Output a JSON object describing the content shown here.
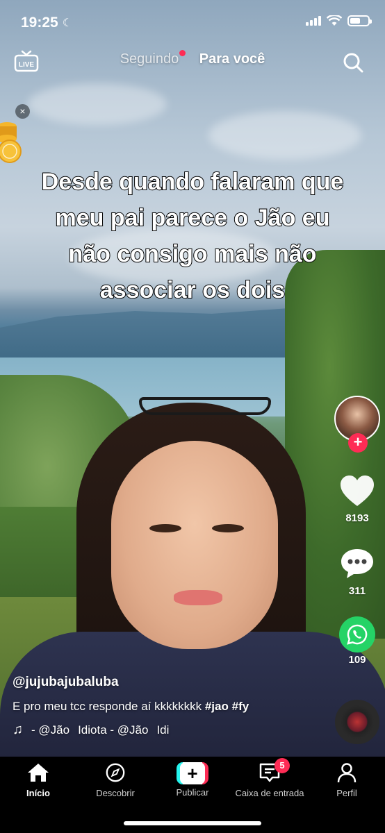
{
  "status_bar": {
    "time": "19:25"
  },
  "top_nav": {
    "live_label": "LIVE",
    "tabs": [
      {
        "label": "Seguindo",
        "active": false
      },
      {
        "label": "Para você",
        "active": true
      }
    ]
  },
  "video": {
    "caption_lines": [
      "Desde quando falaram que",
      "meu pai parece o Jão eu",
      "não consigo mais não",
      "associar os dois"
    ]
  },
  "right_rail": {
    "likes": "8193",
    "comments": "311",
    "shares": "109"
  },
  "info": {
    "username": "@jujubajubaluba",
    "description": "E pro meu tcc responde aí kkkkkkkk",
    "hashtags": [
      "#jao",
      "#fy"
    ],
    "music_segments": [
      "- @Jão",
      "Idiota - @Jão",
      "Idi"
    ]
  },
  "tab_bar": {
    "items": [
      {
        "label": "Início",
        "active": true
      },
      {
        "label": "Descobrir",
        "active": false
      },
      {
        "label": "Publicar",
        "active": false
      },
      {
        "label": "Caixa de entrada",
        "active": false,
        "badge": "5"
      },
      {
        "label": "Perfil",
        "active": false
      }
    ]
  },
  "colors": {
    "accent": "#fe2c55",
    "cyan": "#25f4ee",
    "whatsapp": "#25d366"
  },
  "icons": {
    "live": "live-tv-icon",
    "search": "search-icon",
    "heart": "heart-icon",
    "comment": "comment-icon",
    "whatsapp": "whatsapp-icon",
    "music": "music-note-icon",
    "home": "home-icon",
    "discover": "compass-icon",
    "publish": "plus-icon",
    "inbox": "inbox-icon",
    "profile": "person-icon"
  }
}
